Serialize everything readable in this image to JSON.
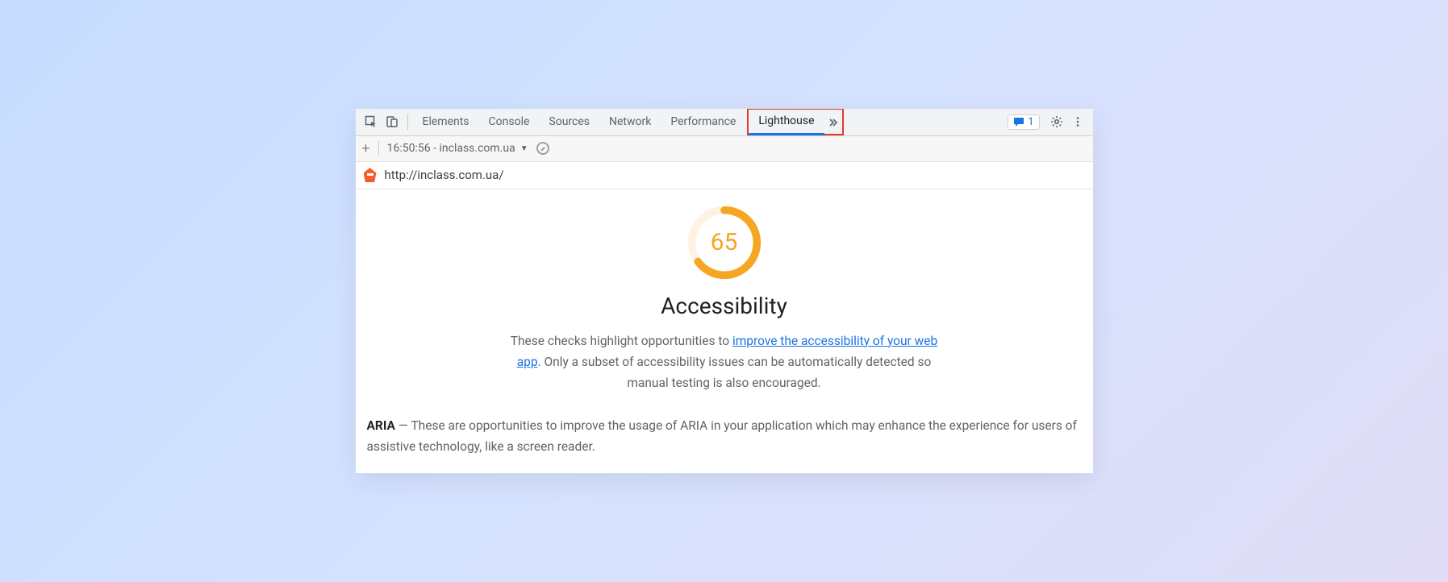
{
  "tabs": {
    "elements": "Elements",
    "console": "Console",
    "sources": "Sources",
    "network": "Network",
    "performance": "Performance",
    "lighthouse": "Lighthouse"
  },
  "badge_count": "1",
  "subbar": {
    "run_label": "16:50:56 - inclass.com.ua"
  },
  "url": "http://inclass.com.ua/",
  "report": {
    "score": "65",
    "score_pct": 65,
    "category": "Accessibility",
    "desc_prefix": "These checks highlight opportunities to ",
    "desc_link": "improve the accessibility of your web app",
    "desc_suffix": ". Only a subset of accessibility issues can be automatically detected so manual testing is also encouraged.",
    "aria_label": "ARIA",
    "aria_sep": "  —  ",
    "aria_text": "These are opportunities to improve the usage of ARIA in your application which may enhance the experience for users of assistive technology, like a screen reader."
  },
  "colors": {
    "gauge": "#f5a623",
    "gauge_track": "#fef3e2"
  }
}
